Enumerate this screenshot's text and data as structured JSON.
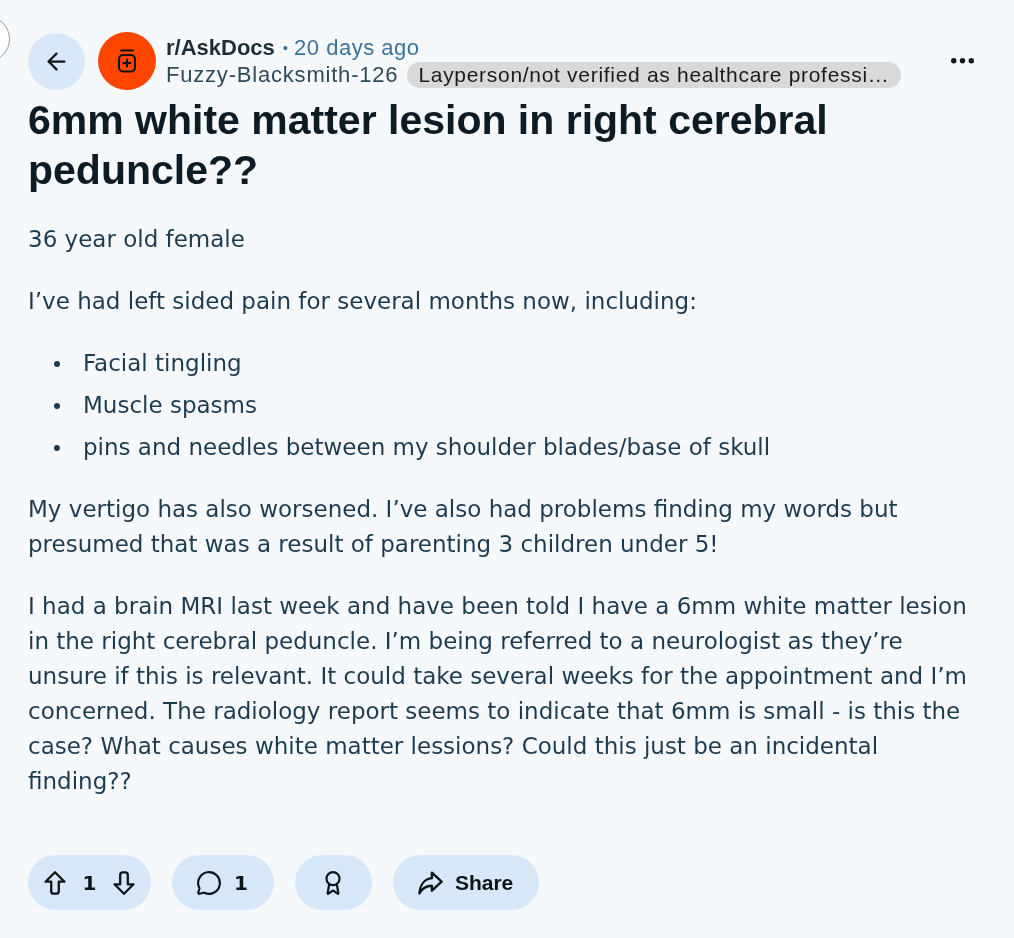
{
  "header": {
    "subreddit": "r/AskDocs",
    "separator": "•",
    "time": "20 days ago",
    "author": "Fuzzy-Blacksmith-126",
    "flair": "Layperson/not verified as healthcare professi…"
  },
  "post": {
    "title": "6mm white matter lesion in right cerebral peduncle??",
    "body": [
      {
        "kind": "paragraph",
        "text": "36 year old female"
      },
      {
        "kind": "paragraph",
        "text": "I’ve had left sided pain for several months now, including:"
      },
      {
        "kind": "bullet_list",
        "items": [
          "Facial tingling",
          "Muscle spasms",
          "pins and needles between my shoulder blades/base of skull"
        ]
      },
      {
        "kind": "paragraph",
        "text": "My vertigo has also worsened. I’ve also had problems finding my words but presumed that was a result of parenting 3 children under 5!"
      },
      {
        "kind": "paragraph",
        "text": "I had a brain MRI last week and have been told I have a 6mm white matter lesion in the right cerebral peduncle. I’m being referred to a neurologist as they’re unsure if this is relevant. It could take several weeks for the appointment and I’m concerned. The radiology report seems to indicate that 6mm is small - is this the case? What causes white matter lessions? Could this just be an incidental finding??"
      }
    ]
  },
  "actions": {
    "score": "1",
    "comments": "1",
    "share": "Share"
  }
}
